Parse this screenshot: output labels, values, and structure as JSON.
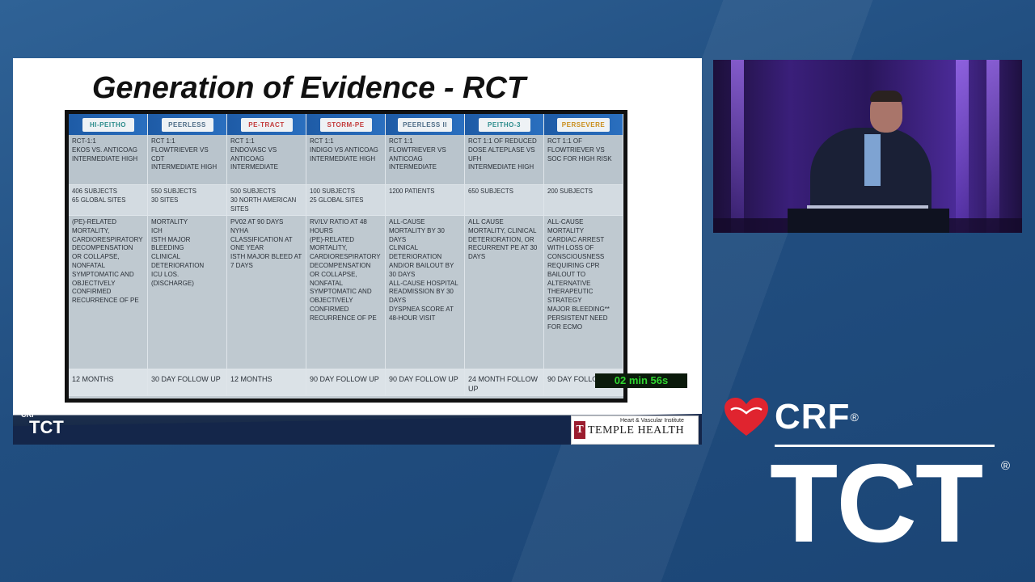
{
  "slide": {
    "title": "Generation of Evidence - RCT",
    "trials": [
      {
        "logo": "HI-PEITHO",
        "design": "RCT-1:1\nEKOS VS. ANTICOAG\nINTERMEDIATE HIGH",
        "subjects": "406 SUBJECTS\n65 GLOBAL SITES",
        "outcomes": "(PE)-RELATED MORTALITY, CARDIORESPIRATORY DECOMPENSATION OR COLLAPSE, NONFATAL SYMPTOMATIC AND OBJECTIVELY CONFIRMED RECURRENCE OF PE",
        "followup": "12 MONTHS"
      },
      {
        "logo": "PEERLESS",
        "design": "RCT 1:1\nFLOWTRIEVER VS CDT\nINTERMEDIATE HIGH",
        "subjects": "550 SUBJECTS\n30 SITES",
        "outcomes": "MORTALITY\nICH\nISTH MAJOR BLEEDING\nCLINICAL DETERIORATION\nICU LOS.\n(DISCHARGE)",
        "followup": "30 DAY FOLLOW UP"
      },
      {
        "logo": "PE-TRACT",
        "design": "RCT 1:1\nENDOVASC VS ANTICOAG\nINTERMEDIATE",
        "subjects": "500 SUBJECTS\n30 NORTH AMERICAN SITES",
        "outcomes": "PV02 AT 90 DAYS\nNYHA CLASSIFICATION AT ONE YEAR\nISTH MAJOR BLEED AT 7 DAYS",
        "followup": "12 MONTHS"
      },
      {
        "logo": "STORM-PE",
        "design": "RCT 1:1\nINDIGO VS ANTICOAG\nINTERMEDIATE HIGH",
        "subjects": "100 SUBJECTS\n25 GLOBAL SITES",
        "outcomes": "RV/LV RATIO AT 48 HOURS\n(PE)-RELATED MORTALITY, CARDIORESPIRATORY DECOMPENSATION OR COLLAPSE, NONFATAL SYMPTOMATIC AND OBJECTIVELY CONFIRMED RECURRENCE OF PE",
        "followup": "90 DAY FOLLOW UP"
      },
      {
        "logo": "PEERLESS II",
        "design": "RCT 1:1\nFLOWTRIEVER VS ANTICOAG\nINTERMEDIATE",
        "subjects": "1200 PATIENTS",
        "outcomes": "ALL-CAUSE MORTALITY BY 30 DAYS\nCLINICAL DETERIORATION AND/OR BAILOUT BY 30 DAYS\nALL-CAUSE HOSPITAL READMISSION BY 30 DAYS\nDYSPNEA SCORE AT 48-HOUR VISIT",
        "followup": "90 DAY FOLLOW UP"
      },
      {
        "logo": "PEITHO-3",
        "design": "RCT 1:1 OF REDUCED DOSE ALTEPLASE VS UFH\nINTERMEDIATE HIGH",
        "subjects": "650 SUBJECTS",
        "outcomes": "ALL CAUSE MORTALITY, CLINICAL DETERIORATION, OR RECURRENT PE AT 30 DAYS",
        "followup": "24 MONTH FOLLOW UP"
      },
      {
        "logo": "PERSEVERE",
        "design": "RCT 1:1 of FLOWTRIEVER VS SOC FOR HIGH RISK",
        "subjects": "200 SUBJECTS",
        "outcomes": "ALL-CAUSE MORTALITY\nCARDIAC ARREST WITH LOSS OF CONSCIOUSNESS REQUIRING CPR\nBAILOUT TO ALTERNATIVE THERAPEUTIC STRATEGY\nMAJOR BLEEDING**\nPERSISTENT NEED FOR ECMO",
        "followup": "90 DAY FOLLOW UP"
      }
    ]
  },
  "footer": {
    "mini_crf": "CRF",
    "mini_tct": "TCT",
    "temple_institute": "Heart & Vascular Institute",
    "temple_name": "TEMPLE HEALTH",
    "timer": "02 min 56s"
  },
  "branding": {
    "crf": "CRF",
    "crf_reg": "®",
    "tct": "TCT",
    "tct_reg": "®",
    "heart_color": "#e0242f"
  },
  "icons": {
    "heart": "heart-icon",
    "temple_logo": "temple-t-icon"
  }
}
